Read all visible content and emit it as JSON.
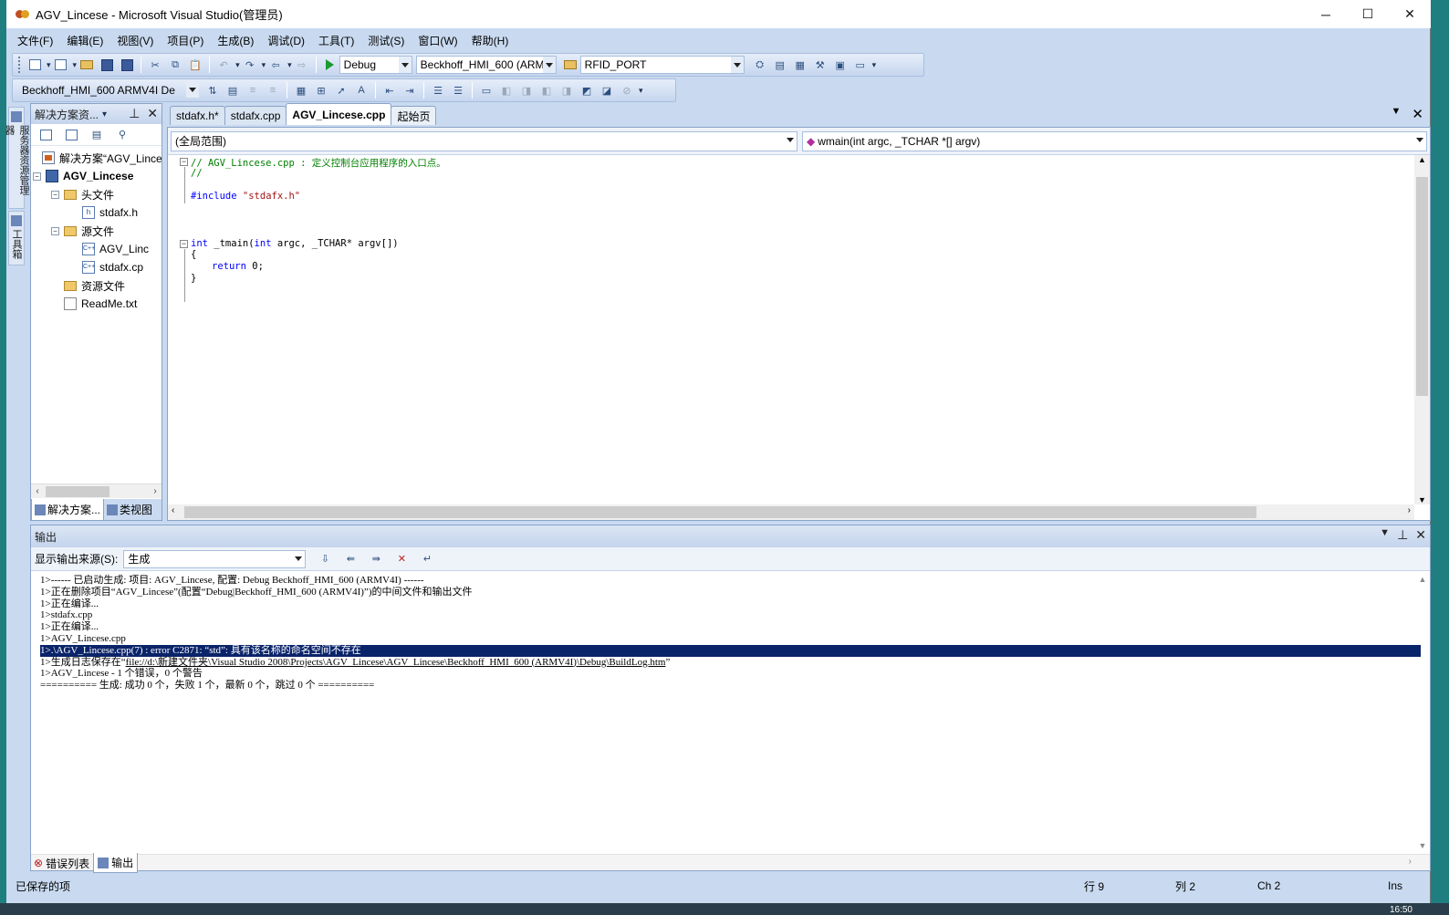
{
  "window": {
    "title": "AGV_Lincese - Microsoft Visual Studio(管理员)",
    "minimize": "─",
    "maximize": "☐",
    "close": "✕"
  },
  "menu": [
    "文件(F)",
    "编辑(E)",
    "视图(V)",
    "项目(P)",
    "生成(B)",
    "调试(D)",
    "工具(T)",
    "测试(S)",
    "窗口(W)",
    "帮助(H)"
  ],
  "toolbar1": {
    "config": "Debug",
    "platform": "Beckhoff_HMI_600 (ARM",
    "find": "RFID_PORT"
  },
  "toolbar2": {
    "device": "Beckhoff_HMI_600 ARMV4I De"
  },
  "left_tabs": [
    "服务器资源管理器",
    "工具箱"
  ],
  "solution_explorer": {
    "title": "解决方案资...",
    "pin": "📌",
    "close": "✕",
    "tree": [
      {
        "label": "解决方案“AGV_Lince",
        "icon": "solution-icon",
        "level": 0,
        "expander": ""
      },
      {
        "label": "AGV_Lincese",
        "icon": "project-icon",
        "level": 0,
        "expander": "−",
        "bold": true
      },
      {
        "label": "头文件",
        "icon": "folder-icon",
        "level": 1,
        "expander": "−"
      },
      {
        "label": "stdafx.h",
        "icon": "header-file-icon",
        "level": 2,
        "expander": ""
      },
      {
        "label": "源文件",
        "icon": "folder-icon",
        "level": 1,
        "expander": "−"
      },
      {
        "label": "AGV_Linc",
        "icon": "cpp-file-icon",
        "level": 2,
        "expander": ""
      },
      {
        "label": "stdafx.cp",
        "icon": "cpp-file-icon",
        "level": 2,
        "expander": ""
      },
      {
        "label": "资源文件",
        "icon": "folder-icon",
        "level": 1,
        "expander": ""
      },
      {
        "label": "ReadMe.txt",
        "icon": "text-file-icon",
        "level": 1,
        "expander": ""
      }
    ],
    "bottom_tabs": [
      "解决方案...",
      "类视图"
    ]
  },
  "editor": {
    "tabs": [
      "stdafx.h*",
      "stdafx.cpp",
      "AGV_Lincese.cpp",
      "起始页"
    ],
    "active_tab": "AGV_Lincese.cpp",
    "scope": "(全局范围)",
    "function": "wmain(int argc, _TCHAR *[] argv)",
    "code": {
      "l1": "// AGV_Lincese.cpp : 定义控制台应用程序的入口点。",
      "l2": "//",
      "l3_pp": "#include ",
      "l3_str": "\"stdafx.h\"",
      "l4_kw": "int",
      "l4_rest": " _tmain(",
      "l4_kw2": "int",
      "l4_rest2": " argc, _TCHAR* argv[])",
      "l5": "{",
      "l6_kw": "return",
      "l6_rest": " 0;",
      "l7": "}"
    }
  },
  "output": {
    "title": "输出",
    "source_label": "显示输出来源(S):",
    "source_value": "生成",
    "lines": [
      "1>------ 已启动生成: 项目: AGV_Lincese, 配置: Debug Beckhoff_HMI_600 (ARMV4I) ------",
      "1>正在删除项目“AGV_Lincese”(配置“Debug|Beckhoff_HMI_600 (ARMV4I)”)的中间文件和输出文件",
      "1>正在编译...",
      "1>stdafx.cpp",
      "1>正在编译...",
      "1>AGV_Lincese.cpp",
      "1>.\\AGV_Lincese.cpp(7) : error C2871: “std”: 具有该名称的命名空间不存在",
      "1>生成日志保存在“",
      "1>AGV_Lincese - 1 个错误，0 个警告",
      "========== 生成: 成功 0 个，失败 1 个，最新 0 个，跳过 0 个 =========="
    ],
    "log_link": "file://d:\\新建文件夹\\Visual Studio 2008\\Projects\\AGV_Lincese\\AGV_Lincese\\Beckhoff_HMI_600 (ARMV4I)\\Debug\\BuildLog.htm",
    "log_suffix": "”",
    "bottom_tabs": [
      "错误列表",
      "输出"
    ]
  },
  "statusbar": {
    "message": "已保存的项",
    "line": "行 9",
    "col": "列 2",
    "ch": "Ch 2",
    "mode": "Ins"
  },
  "taskbar": {
    "clock": "16:50"
  }
}
